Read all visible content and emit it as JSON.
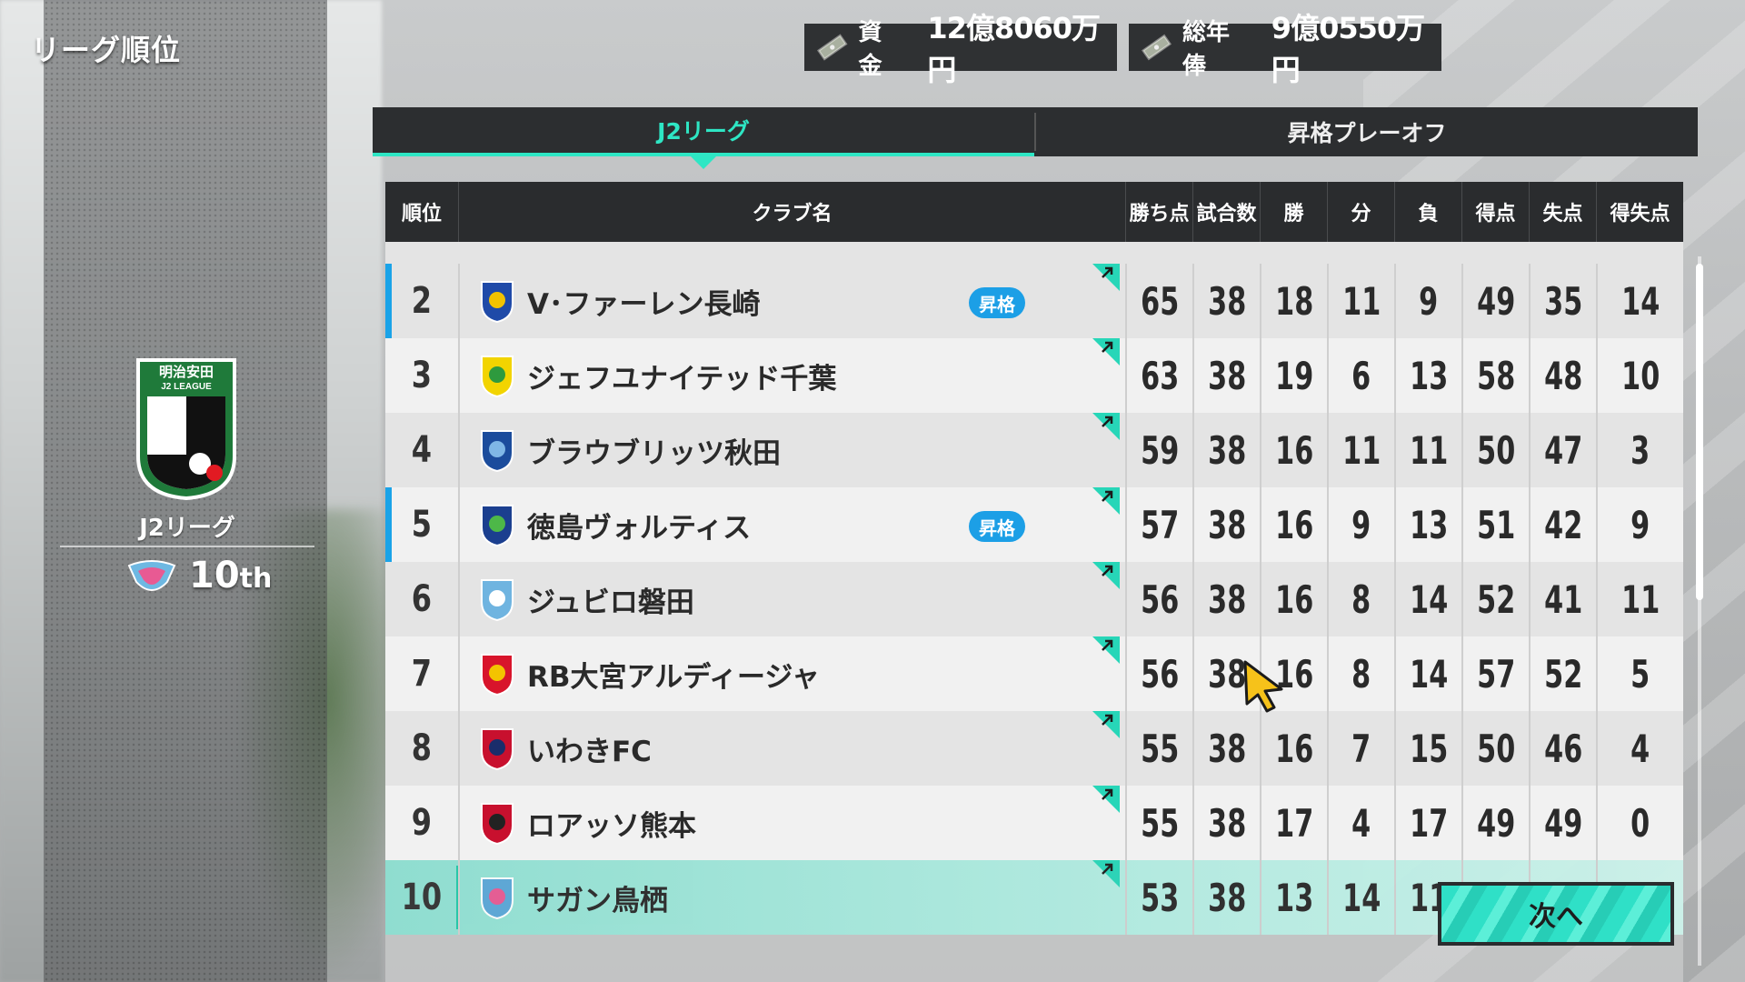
{
  "screen": {
    "title": "リーグ順位"
  },
  "finance": {
    "funds_label": "資金",
    "funds_value": "12億8060万円",
    "salary_label": "総年俸",
    "salary_value": "9億0550万円"
  },
  "league_panel": {
    "emblem_text_top": "明治安田",
    "emblem_text_bottom": "J2 LEAGUE",
    "league_name": "J2リーグ",
    "my_rank_number": "10",
    "my_rank_suffix": "th"
  },
  "tabs": [
    {
      "label": "J2リーグ",
      "active": true
    },
    {
      "label": "昇格プレーオフ",
      "active": false
    }
  ],
  "table": {
    "headers": [
      "順位",
      "クラブ名",
      "勝ち点",
      "試合数",
      "勝",
      "分",
      "負",
      "得点",
      "失点",
      "得失点"
    ],
    "promo_badge_label": "昇格",
    "rows": [
      {
        "rank": "2",
        "club": "V･ファーレン長崎",
        "points": "65",
        "played": "38",
        "won": "18",
        "drawn": "11",
        "lost": "9",
        "gf": "49",
        "ga": "35",
        "gd": "14",
        "promo": true,
        "logo_color": "#1f4aa8",
        "logo_accent": "#f2c200"
      },
      {
        "rank": "3",
        "club": "ジェフユナイテッド千葉",
        "points": "63",
        "played": "38",
        "won": "19",
        "drawn": "6",
        "lost": "13",
        "gf": "58",
        "ga": "48",
        "gd": "10",
        "promo": false,
        "logo_color": "#f2d400",
        "logo_accent": "#2e9a3e"
      },
      {
        "rank": "4",
        "club": "ブラウブリッツ秋田",
        "points": "59",
        "played": "38",
        "won": "16",
        "drawn": "11",
        "lost": "11",
        "gf": "50",
        "ga": "47",
        "gd": "3",
        "promo": false,
        "logo_color": "#1b4c9c",
        "logo_accent": "#7fb7e6"
      },
      {
        "rank": "5",
        "club": "徳島ヴォルティス",
        "points": "57",
        "played": "38",
        "won": "16",
        "drawn": "9",
        "lost": "13",
        "gf": "51",
        "ga": "42",
        "gd": "9",
        "promo": true,
        "logo_color": "#1b3f8f",
        "logo_accent": "#4db848"
      },
      {
        "rank": "6",
        "club": "ジュビロ磐田",
        "points": "56",
        "played": "38",
        "won": "16",
        "drawn": "8",
        "lost": "14",
        "gf": "52",
        "ga": "41",
        "gd": "11",
        "promo": false,
        "logo_color": "#6fb4e0",
        "logo_accent": "#ffffff"
      },
      {
        "rank": "7",
        "club": "RB大宮アルディージャ",
        "points": "56",
        "played": "38",
        "won": "16",
        "drawn": "8",
        "lost": "14",
        "gf": "57",
        "ga": "52",
        "gd": "5",
        "promo": false,
        "logo_color": "#d8142b",
        "logo_accent": "#f3c300"
      },
      {
        "rank": "8",
        "club": "いわきFC",
        "points": "55",
        "played": "38",
        "won": "16",
        "drawn": "7",
        "lost": "15",
        "gf": "50",
        "ga": "46",
        "gd": "4",
        "promo": false,
        "logo_color": "#c8102e",
        "logo_accent": "#1a2d6b"
      },
      {
        "rank": "9",
        "club": "ロアッソ熊本",
        "points": "55",
        "played": "38",
        "won": "17",
        "drawn": "4",
        "lost": "17",
        "gf": "49",
        "ga": "49",
        "gd": "0",
        "promo": false,
        "logo_color": "#c8102e",
        "logo_accent": "#222222"
      },
      {
        "rank": "10",
        "club": "サガン鳥栖",
        "points": "53",
        "played": "38",
        "won": "13",
        "drawn": "14",
        "lost": "11",
        "gf": "",
        "ga": "",
        "gd": "",
        "promo": false,
        "mine": true,
        "logo_color": "#5aa7d8",
        "logo_accent": "#e85a93"
      }
    ]
  },
  "next_button": {
    "label": "次へ"
  },
  "colors": {
    "accent": "#2ee6c4",
    "promo_blue": "#1c9fe6",
    "header_bg": "#2a2c2e"
  },
  "icons": {
    "money": "banknote-icon",
    "trend": "trend-up-arrow-icon",
    "cursor": "pointer-cursor-icon"
  }
}
